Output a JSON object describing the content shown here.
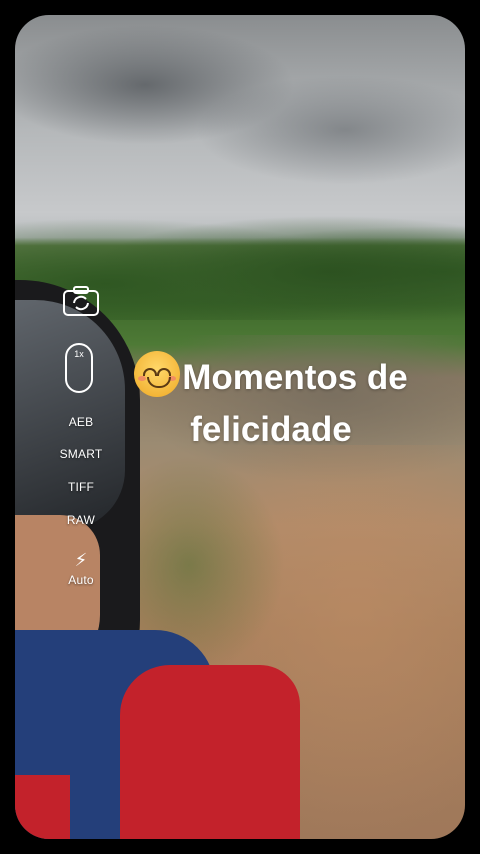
{
  "camera": {
    "zoom_label": "1x",
    "modes": [
      {
        "label": "AEB"
      },
      {
        "label": "SMART"
      },
      {
        "label": "TIFF"
      },
      {
        "label": "RAW"
      }
    ],
    "flash": {
      "icon": "flash-icon",
      "label": "Auto"
    },
    "switch_icon": "camera-switch-icon"
  },
  "caption": {
    "emoji": "smiling-face-emoji",
    "text": "Momentos de felicidade"
  },
  "colors": {
    "background": "#000000",
    "text": "#ffffff"
  }
}
